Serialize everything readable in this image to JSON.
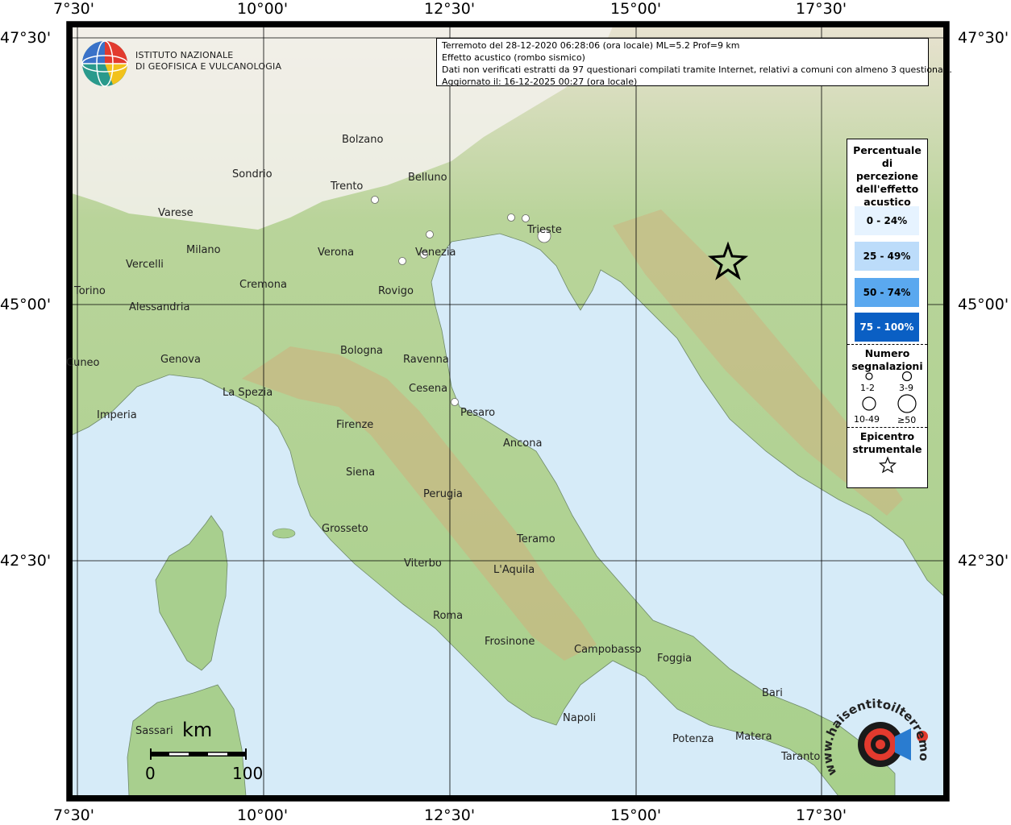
{
  "info": {
    "line1": "Terremoto del 28-12-2020 06:28:06 (ora locale) ML=5.2 Prof=9 km",
    "line2": "Effetto acustico (rombo sismico)",
    "line3": "Dati non verificati estratti da 97 questionari compilati tramite Internet, relativi a comuni con almeno 3 questionari.",
    "line4": "Aggiornato il: 16-12-2025 00:27 (ora locale)"
  },
  "axes": {
    "lon_labels": [
      "7°30'",
      "10°00'",
      "12°30'",
      "15°00'",
      "17°30'"
    ],
    "lat_labels": [
      "47°30'",
      "45°00'",
      "42°30'"
    ]
  },
  "logo": {
    "line1": "Istituto Nazionale",
    "line2": "di Geofisica e Vulcanologia"
  },
  "legend": {
    "title": "Percentuale di percezione dell'effetto acustico",
    "bins": [
      {
        "label": "0 - 24%",
        "color": "#e6f3ff"
      },
      {
        "label": "25 - 49%",
        "color": "#bcdcfa"
      },
      {
        "label": "50 - 74%",
        "color": "#5aa8ef"
      },
      {
        "label": "75 - 100%",
        "color": "#0a5fc4"
      }
    ],
    "count_title": "Numero segnalazioni",
    "counts": [
      "1-2",
      "3-9",
      "10-49",
      "≥50"
    ],
    "epicenter_title": "Epicentro strumentale"
  },
  "scale": {
    "unit": "km",
    "min": "0",
    "max": "100"
  },
  "cities": [
    "Bolzano",
    "Sondrio",
    "Trento",
    "Belluno",
    "Varese",
    "Trieste",
    "Milano",
    "Verona",
    "Venezia",
    "Vercelli",
    "Torino",
    "Cremona",
    "Rovigo",
    "Alessandria",
    "Cuneo",
    "Genova",
    "Bologna",
    "Ravenna",
    "Cesena",
    "La Spezia",
    "Pesaro",
    "Imperia",
    "Firenze",
    "Ancona",
    "Siena",
    "Perugia",
    "Grosseto",
    "Teramo",
    "Viterbo",
    "L'Aquila",
    "Roma",
    "Frosinone",
    "Campobasso",
    "Foggia",
    "Bari",
    "Sassari",
    "Napoli",
    "Potenza",
    "Matera",
    "Taranto"
  ],
  "hst_text": "www.haisentitoilterremoto.it",
  "colors": {
    "sea": "#d6ebf8",
    "lowland": "#9fcf8a",
    "hills": "#d8cf98",
    "mountains": "#c9a77a",
    "alps_snow": "#f4f4f4",
    "obs_fill": "#ffffff"
  }
}
